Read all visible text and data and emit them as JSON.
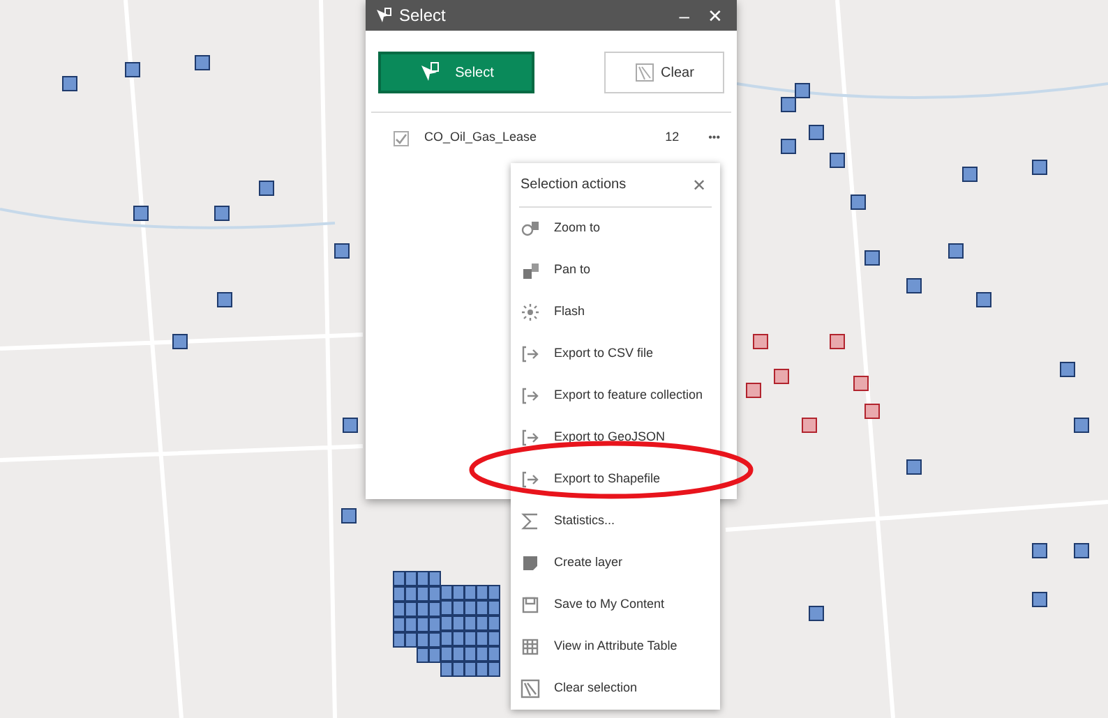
{
  "panel": {
    "title": "Select",
    "minimize": "–",
    "close": "✕",
    "select_button": "Select",
    "clear_button": "Clear",
    "layers": [
      {
        "name": "CO_Oil_Gas_Lease",
        "checked": true,
        "count": "12",
        "more": "•••"
      }
    ]
  },
  "menu": {
    "title": "Selection actions",
    "close": "✕",
    "items": [
      {
        "label": "Zoom to"
      },
      {
        "label": "Pan to"
      },
      {
        "label": "Flash"
      },
      {
        "label": "Export to CSV file"
      },
      {
        "label": "Export to feature collection"
      },
      {
        "label": "Export to GeoJSON"
      },
      {
        "label": "Export to Shapefile"
      },
      {
        "label": "Statistics..."
      },
      {
        "label": "Create layer"
      },
      {
        "label": "Save to My Content"
      },
      {
        "label": "View in Attribute Table"
      },
      {
        "label": "Clear selection"
      }
    ]
  }
}
